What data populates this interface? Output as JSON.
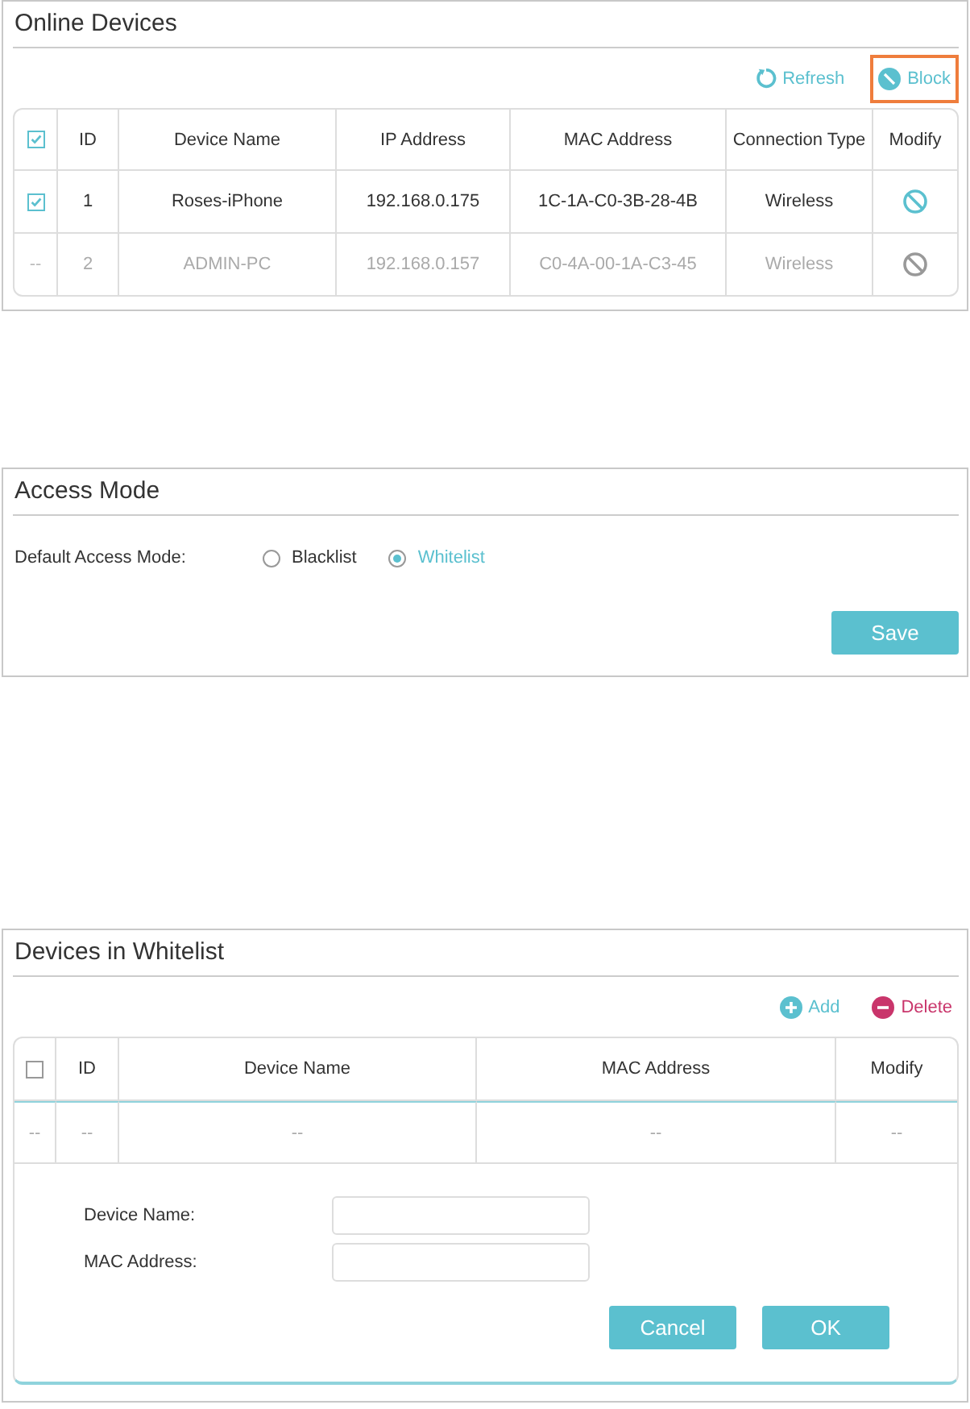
{
  "online_devices": {
    "title": "Online Devices",
    "toolbar": [
      {
        "kind": "refresh",
        "label": "Refresh",
        "highlighted": false
      },
      {
        "kind": "block",
        "label": "Block",
        "highlighted": true
      }
    ],
    "header_checked": true,
    "columns": [
      "ID",
      "Device Name",
      "IP Address",
      "MAC Address",
      "Connection Type",
      "Modify"
    ],
    "rows": [
      {
        "disabled": false,
        "checked": true,
        "id": "1",
        "device_name": "Roses-iPhone",
        "ip_address": "192.168.0.175",
        "mac_address": "1C-1A-C0-3B-28-4B",
        "connection_type": "Wireless"
      },
      {
        "disabled": true,
        "select_text": "--",
        "id": "2",
        "device_name": "ADMIN-PC",
        "ip_address": "192.168.0.157",
        "mac_address": "C0-4A-00-1A-C3-45",
        "connection_type": "Wireless"
      }
    ]
  },
  "access_mode": {
    "title": "Access Mode",
    "label": "Default Access Mode:",
    "options": [
      {
        "label": "Blacklist",
        "selected": false
      },
      {
        "label": "Whitelist",
        "selected": true
      }
    ],
    "button": "Save"
  },
  "whitelist": {
    "title": "Devices in Whitelist",
    "toolbar": [
      {
        "kind": "add",
        "label": "Add"
      },
      {
        "kind": "delete",
        "label": "Delete"
      }
    ],
    "header_checked": false,
    "columns": [
      "ID",
      "Device Name",
      "MAC Address",
      "Modify"
    ],
    "row": [
      "--",
      "--",
      "--",
      "--",
      "--"
    ],
    "fields": [
      {
        "label": "Device Name:"
      },
      {
        "label": "MAC Address:"
      }
    ],
    "buttons": [
      "Cancel",
      "OK"
    ]
  }
}
